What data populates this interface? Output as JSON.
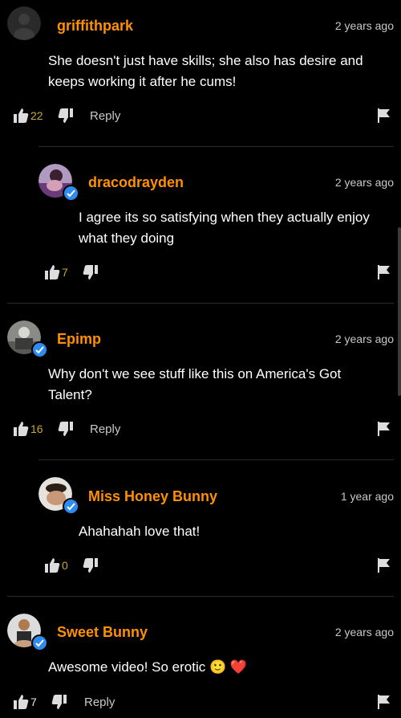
{
  "comments": [
    {
      "username": "griffithpark",
      "time": "2 years ago",
      "text": "She doesn't just have skills; she also has desire and keeps working it after he cums!",
      "likes": "22",
      "reply": "Reply",
      "verified": false
    },
    {
      "username": "dracodrayden",
      "time": "2 years ago",
      "text": "I agree its so satisfying when they actually enjoy what they doing",
      "likes": "7",
      "reply": "",
      "verified": true
    },
    {
      "username": "Epimp",
      "time": "2 years ago",
      "text": "Why don't we see stuff like this on America's Got Talent?",
      "likes": "16",
      "reply": "Reply",
      "verified": true
    },
    {
      "username": "Miss Honey Bunny",
      "time": "1 year ago",
      "text": "Ahahahah love that!",
      "likes": "0",
      "reply": "",
      "verified": true
    },
    {
      "username": "Sweet Bunny",
      "time": "2 years ago",
      "text": "Awesome video! So erotic 🙂 ❤️",
      "likes": "7",
      "reply": "Reply",
      "verified": true
    }
  ],
  "colors": {
    "accent": "#ff9000",
    "verified": "#2e8cf0",
    "background": "#000000"
  },
  "icons": [
    "thumbs-up-icon",
    "thumbs-down-icon",
    "flag-icon",
    "verified-check-icon"
  ]
}
